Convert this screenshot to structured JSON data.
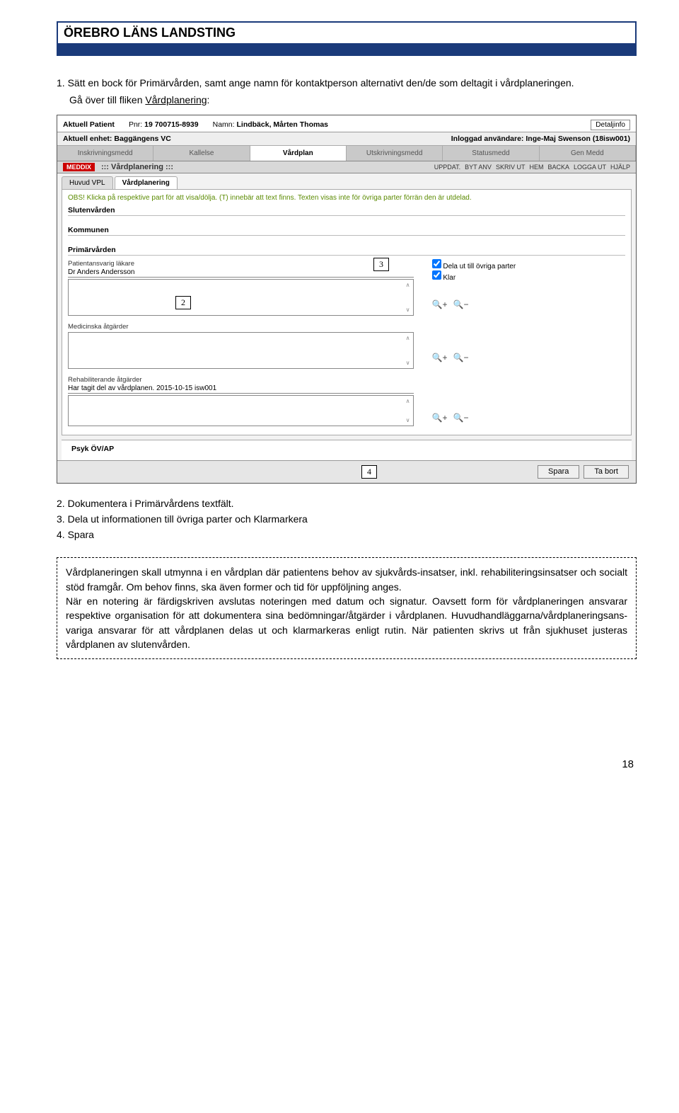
{
  "header": {
    "org": "ÖREBRO LÄNS LANDSTING"
  },
  "intro": {
    "item1_num": "1.",
    "item1_text": "Sätt en bock för Primärvården, samt ange namn för kontaktperson alternativt den/de som deltagit i vårdplaneringen.",
    "subline_prefix": "Gå över till fliken ",
    "subline_underlined": "Vårdplanering",
    "subline_suffix": ":"
  },
  "shot": {
    "aktuell_patient_lbl": "Aktuell Patient",
    "pnr_lbl": "Pnr:",
    "pnr_val": "19 700715-8939",
    "namn_lbl": "Namn:",
    "namn_val": "Lindbäck, Mårten Thomas",
    "detaljinfo": "Detaljinfo",
    "enhet_lbl": "Aktuell enhet:",
    "enhet_val": "Baggängens VC",
    "inloggad_lbl": "Inloggad användare:",
    "inloggad_val": "Inge-Maj Swenson (18isw001)",
    "tabs": {
      "t1": "Inskrivningsmedd",
      "t2": "Kallelse",
      "t3": "Vårdplan",
      "t4": "Utskrivningsmedd",
      "t5": "Statusmedd",
      "t6": "Gen Medd"
    },
    "meddix": "MEDDIX",
    "vardplanering": "::: Vårdplanering :::",
    "toolbar": {
      "i1": "UPPDAT.",
      "i2": "BYT ANV",
      "i3": "SKRIV UT",
      "i4": "HEM",
      "i5": "BACKA",
      "i6": "LOGGA UT",
      "i7": "HJÄLP"
    },
    "subtabs": {
      "s1": "Huvud VPL",
      "s2": "Vårdplanering"
    },
    "obs": "OBS! Klicka på respektive part för att visa/dölja. (T) innebär att text finns. Texten visas inte för övriga parter förrän den är utdelad.",
    "sec_slutenvarden": "Slutenvården",
    "sec_kommunen": "Kommunen",
    "sec_primarvarden": "Primärvården",
    "patientansvarig_lbl": "Patientansvarig läkare",
    "patientansvarig_val": "Dr Anders Andersson",
    "chk_dela": "Dela ut till övriga parter",
    "chk_klar": "Klar",
    "med_atgarder": "Medicinska åtgärder",
    "rehab_lbl": "Rehabiliterande åtgärder",
    "rehab_val": "Har tagit del av vårdplanen. 2015-10-15 isw001",
    "psyk": "Psyk ÖV/AP",
    "callout2": "2",
    "callout3": "3",
    "callout4": "4",
    "spara": "Spara",
    "tabort": "Ta bort"
  },
  "after": {
    "n2": "2.",
    "t2": "Dokumentera i Primärvårdens textfält.",
    "n3": "3.",
    "t3": "Dela ut informationen till övriga parter och Klarmarkera",
    "n4": "4.",
    "t4": "Spara"
  },
  "infobox": {
    "t": "Vårdplaneringen skall utmynna i en vårdplan där patientens behov av sjukvårds-insatser, inkl. rehabiliteringsinsatser och socialt stöd framgår. Om behov finns, ska även former och tid för uppföljning anges.\nNär en notering är färdigskriven avslutas noteringen med datum och signatur. Oavsett form för vårdplaneringen ansvarar respektive organisation för att dokumentera sina bedömningar/åtgärder i vårdplanen. Huvudhandläggarna/vårdplaneringsans-variga ansvarar för att vårdplanen delas ut och klarmarkeras enligt rutin. När patienten skrivs ut från sjukhuset justeras vårdplanen av slutenvården."
  },
  "page_number": "18"
}
